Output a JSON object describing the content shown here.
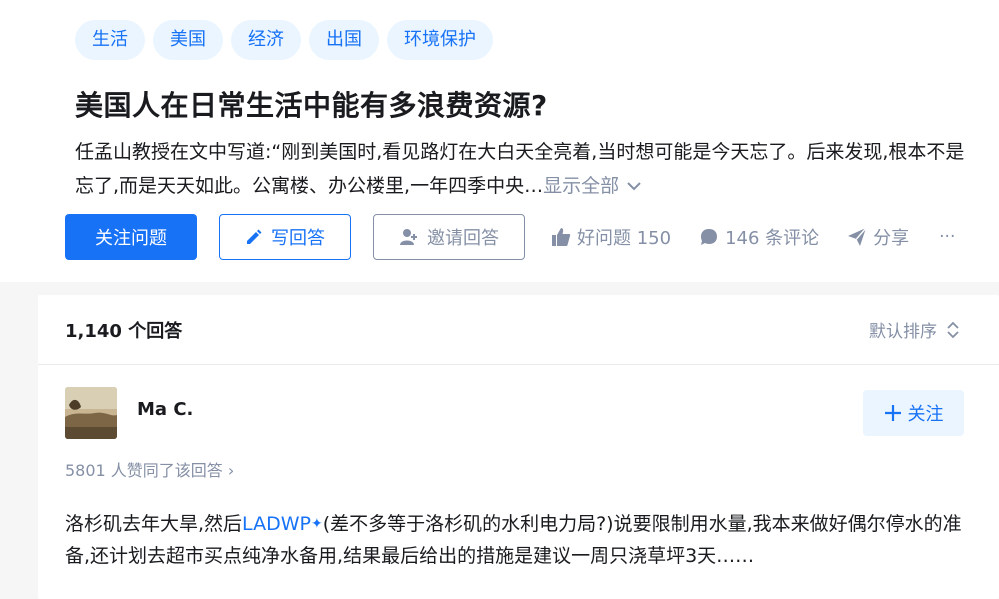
{
  "question": {
    "tags": [
      "生活",
      "美国",
      "经济",
      "出国",
      "环境保护"
    ],
    "title": "美国人在日常生活中能有多浪费资源?",
    "excerpt": "任孟山教授在文中写道:“刚到美国时,看见路灯在大白天全亮着,当时想可能是今天忘了。后来发现,根本不是忘了,而是天天如此。公寓楼、办公楼里,一年四季中央…",
    "show_all": "显示全部",
    "follow_btn": "关注问题",
    "write_btn": "写回答",
    "invite_btn": "邀请回答",
    "good_question": "好问题 150",
    "comments": "146 条评论",
    "share": "分享",
    "more": "···",
    "icons": [
      "pencil-icon",
      "person-add-icon",
      "thumb-up-icon",
      "comment-icon",
      "share-icon",
      "chevron-down-icon"
    ]
  },
  "answers": {
    "count": "1,140 个回答",
    "sort": "默认排序",
    "first": {
      "author": "Ma C.",
      "follow": "关注",
      "votes": "5801 人赞同了该回答",
      "text_before": "洛杉矶去年大旱,然后",
      "link": "LADWP",
      "text_after": "(差不多等于洛杉矶的水利电力局?)说要限制用水量,我本来做好偶尔停水的准备,还计划去超市买点纯净水备用,结果最后给出的措施是建议一周只浇草坪3天……"
    }
  },
  "colors": {
    "accent": "#1772f6",
    "muted": "#8590a6",
    "tag_bg": "#ebf5ff"
  }
}
